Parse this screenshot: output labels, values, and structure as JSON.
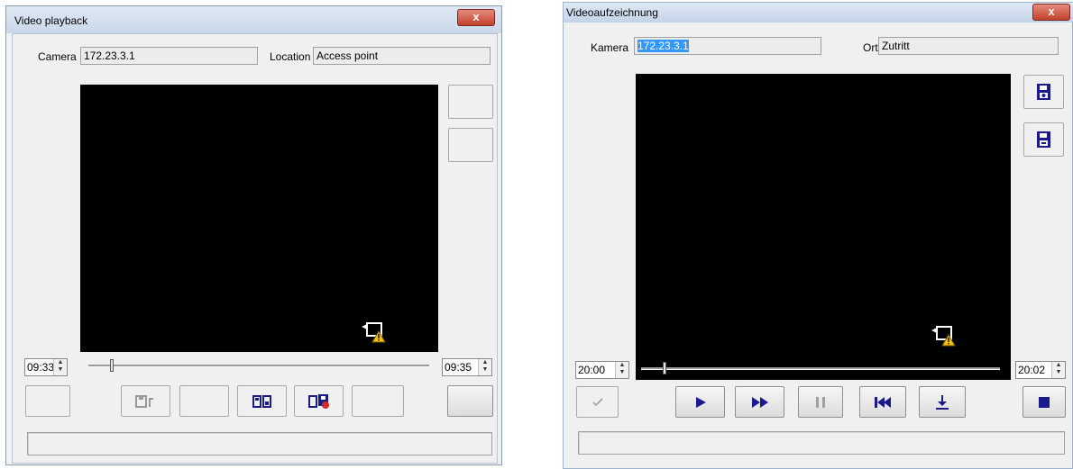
{
  "left_window": {
    "title": "Video playback",
    "close_label": "x",
    "camera_label": "Camera",
    "camera_value": "172.23.3.1",
    "location_label": "Location",
    "location_value": "Access point",
    "start_time": "09:33",
    "end_time": "09:35",
    "icons": [
      "video-warning-icon",
      "save-clip-icon",
      "export-icon",
      "delete-recording-icon"
    ]
  },
  "right_window": {
    "title": "Videoaufzeichnung",
    "close_label": "x",
    "camera_label": "Kamera",
    "camera_value": "172.23.3.1",
    "location_label": "Ort",
    "location_value": "Zutritt",
    "start_time": "20:00",
    "end_time": "20:02",
    "icons": [
      "save-snapshot-icon",
      "save-video-icon",
      "check-icon",
      "play-icon",
      "fast-forward-icon",
      "pause-icon",
      "skip-to-start-icon",
      "download-icon",
      "stop-icon",
      "video-warning-icon"
    ]
  },
  "colors": {
    "accent": "#1a1a8c",
    "selection": "#3399ff",
    "video_bg": "#000000",
    "warning": "#f5c400"
  }
}
